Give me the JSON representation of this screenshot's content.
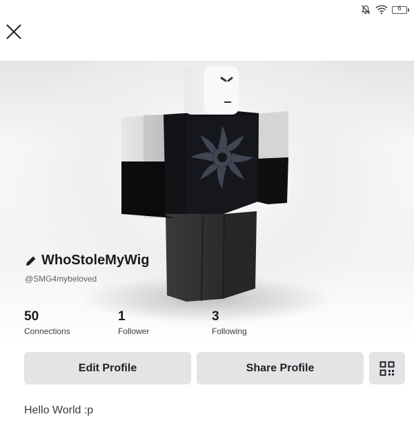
{
  "status_bar": {
    "battery_level": "6",
    "icons": [
      "bell-muted-icon",
      "wifi-icon",
      "battery-icon"
    ]
  },
  "header": {
    "close_icon": "close-icon"
  },
  "profile": {
    "edit_icon": "pencil-icon",
    "display_name": "WhoStoleMyWig",
    "username": "@SMG4mybeloved",
    "stats": [
      {
        "value": "50",
        "label": "Connections"
      },
      {
        "value": "1",
        "label": "Follower"
      },
      {
        "value": "3",
        "label": "Following"
      }
    ],
    "bio": "Hello World :p"
  },
  "actions": {
    "edit_label": "Edit Profile",
    "share_label": "Share Profile",
    "qr_icon": "qr-code-icon"
  }
}
